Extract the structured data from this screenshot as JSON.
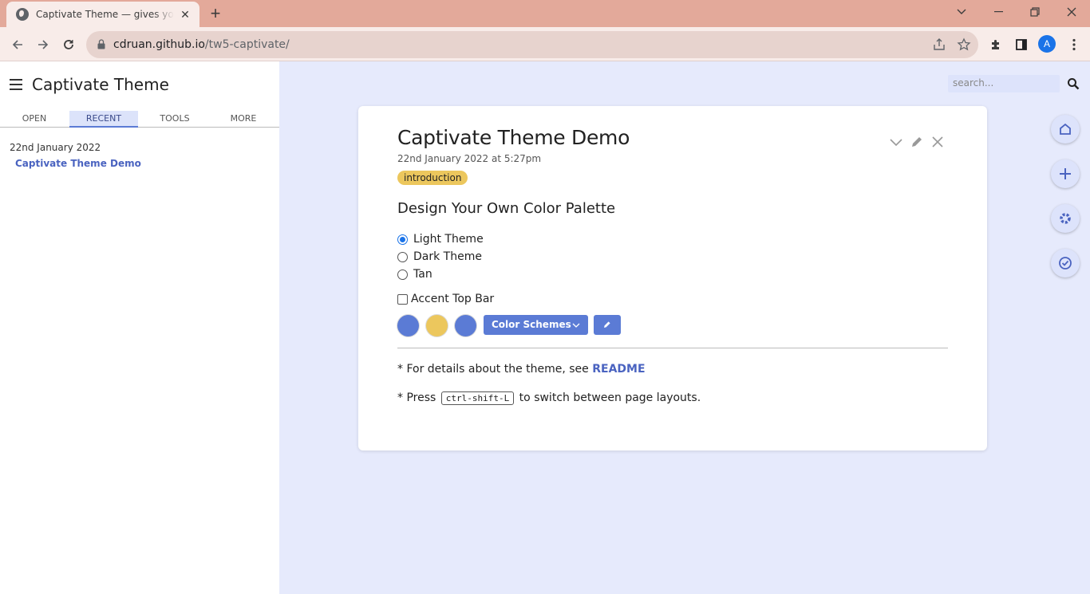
{
  "browser": {
    "tab_title": "Captivate Theme — gives your w",
    "tab_close": "✕",
    "new_tab": "+",
    "url_host": "cdruan.github.io",
    "url_path": "/tw5-captivate/",
    "avatar_letter": "A"
  },
  "sidebar": {
    "title": "Captivate Theme",
    "tabs": [
      {
        "label": "OPEN"
      },
      {
        "label": "RECENT"
      },
      {
        "label": "TOOLS"
      },
      {
        "label": "MORE"
      }
    ],
    "recent_date": "22nd January 2022",
    "recent_link": "Captivate Theme Demo"
  },
  "search": {
    "placeholder": "search..."
  },
  "tiddler": {
    "title": "Captivate Theme Demo",
    "subtitle": "22nd January 2022 at 5:27pm",
    "tag": "introduction",
    "heading": "Design Your Own Color Palette",
    "radios": [
      {
        "label": "Light Theme",
        "checked": true
      },
      {
        "label": "Dark Theme",
        "checked": false
      },
      {
        "label": "Tan",
        "checked": false
      }
    ],
    "checkbox_label": "Accent Top Bar",
    "swatch_colors": [
      "#5b7bd5",
      "#ecc75d",
      "#5b7bd5"
    ],
    "scheme_button": "Color Schemes",
    "readme_prefix": "* For details about the theme, see ",
    "readme_link": "README",
    "press_prefix": "* Press ",
    "press_key": "ctrl-shift-L",
    "press_suffix": " to switch between page layouts."
  },
  "colors": {
    "accent": "#5b7bd5",
    "tag": "#ecc75d",
    "background": "#e6eafc",
    "chrome": "#e3a99a"
  }
}
